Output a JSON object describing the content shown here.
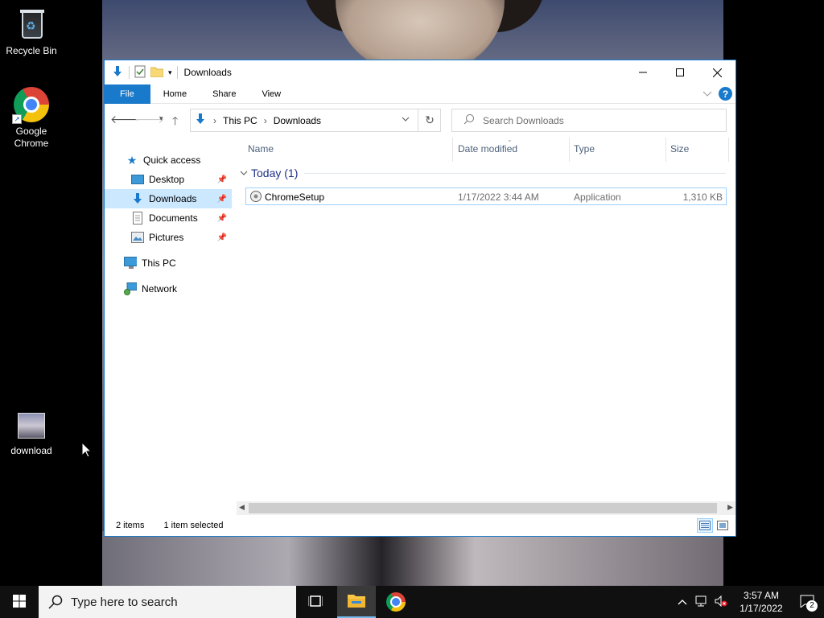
{
  "desktop": {
    "icons": [
      {
        "label": "Recycle Bin"
      },
      {
        "label": "Google Chrome"
      },
      {
        "label": "download"
      }
    ]
  },
  "window": {
    "title": "Downloads",
    "ribbon_tabs": [
      "File",
      "Home",
      "Share",
      "View"
    ],
    "address": {
      "crumbs": [
        "This PC",
        "Downloads"
      ]
    },
    "search_placeholder": "Search Downloads",
    "nav": {
      "quick_access": "Quick access",
      "items": [
        "Desktop",
        "Downloads",
        "Documents",
        "Pictures"
      ],
      "this_pc": "This PC",
      "network": "Network"
    },
    "columns": [
      "Name",
      "Date modified",
      "Type",
      "Size"
    ],
    "group": "Today (1)",
    "files": [
      {
        "name": "ChromeSetup",
        "date": "1/17/2022 3:44 AM",
        "type": "Application",
        "size": "1,310 KB"
      }
    ],
    "status": {
      "items": "2 items",
      "selected": "1 item selected"
    }
  },
  "taskbar": {
    "search_placeholder": "Type here to search",
    "time": "3:57 AM",
    "date": "1/17/2022",
    "notifications": "2"
  },
  "colors": {
    "accent": "#1979ca",
    "selection": "#cce8ff",
    "taskbar": "#101010"
  }
}
